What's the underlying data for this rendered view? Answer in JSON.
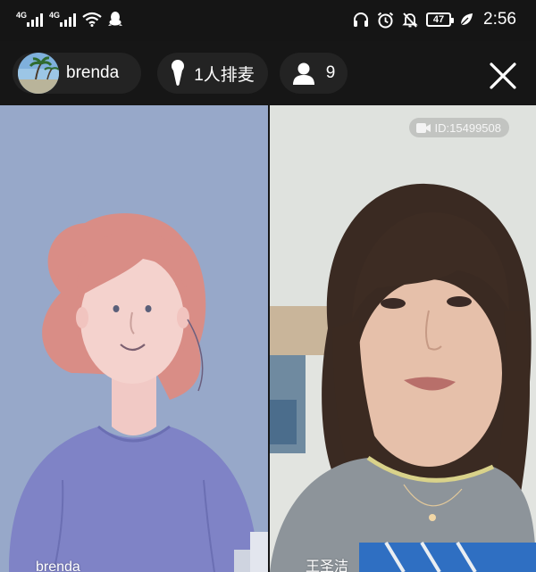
{
  "status_bar": {
    "network_1": "4G",
    "network_2": "4G",
    "battery": "47",
    "time": "2:56",
    "icons": [
      "signal-icon",
      "signal-icon",
      "wifi-icon",
      "qq-icon",
      "headphones-icon",
      "alarm-icon",
      "mute-icon",
      "battery-icon",
      "leaf-icon"
    ]
  },
  "top_bar": {
    "host_name": "brenda",
    "queue_label": "1人排麦",
    "viewer_count": "9",
    "icons": [
      "microphone-icon",
      "person-icon",
      "close-icon"
    ]
  },
  "tiles": {
    "left_label": "brenda",
    "right_label": "王圣洁",
    "room_id": "ID:15499508"
  }
}
